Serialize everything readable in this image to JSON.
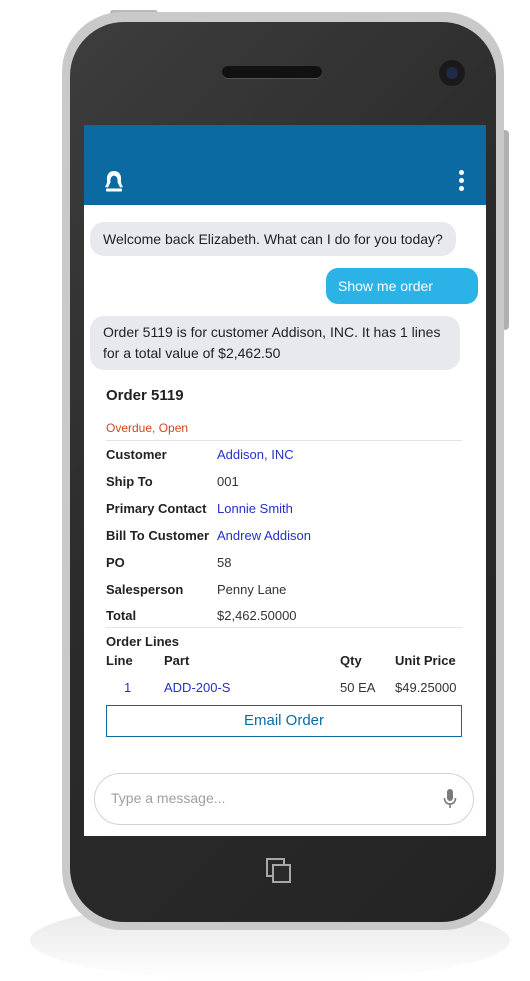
{
  "chat": {
    "welcome": "Welcome back Elizabeth. What can I do for you today?",
    "user_message": "Show me order 5119",
    "summary": "Order 5119 is for customer Addison, INC. It has 1 lines for a total value of $2,462.50"
  },
  "order": {
    "title": "Order 5119",
    "status": "Overdue, Open",
    "fields": {
      "customer_label": "Customer",
      "customer_value": "Addison, INC",
      "ship_to_label": "Ship To",
      "ship_to_value": "001",
      "primary_contact_label": "Primary Contact",
      "primary_contact_value": "Lonnie Smith",
      "bill_to_label": "Bill To Customer",
      "bill_to_value": "Andrew Addison",
      "po_label": "PO",
      "po_value": "58",
      "salesperson_label": "Salesperson",
      "salesperson_value": "Penny Lane",
      "total_label": "Total",
      "total_value": "$2,462.50000"
    },
    "lines_heading": "Order Lines",
    "columns": [
      "Line",
      "Part",
      "Qty",
      "Unit Price"
    ],
    "lines": [
      {
        "line": "1",
        "part": "ADD-200-S",
        "qty": "50 EA",
        "unit_price": "$49.25000"
      }
    ],
    "email_button": "Email Order"
  },
  "input": {
    "placeholder": "Type a message..."
  },
  "icons": {
    "bot": "bot-avatar-icon",
    "menu": "more-vert-icon",
    "mic": "mic-icon",
    "home": "recent-apps-icon"
  },
  "colors": {
    "appbar": "#0b6aa1",
    "user_bubble": "#2bb3e8",
    "bot_bubble": "#e7e9ee",
    "status": "#d0461d",
    "link": "#2531c7"
  }
}
